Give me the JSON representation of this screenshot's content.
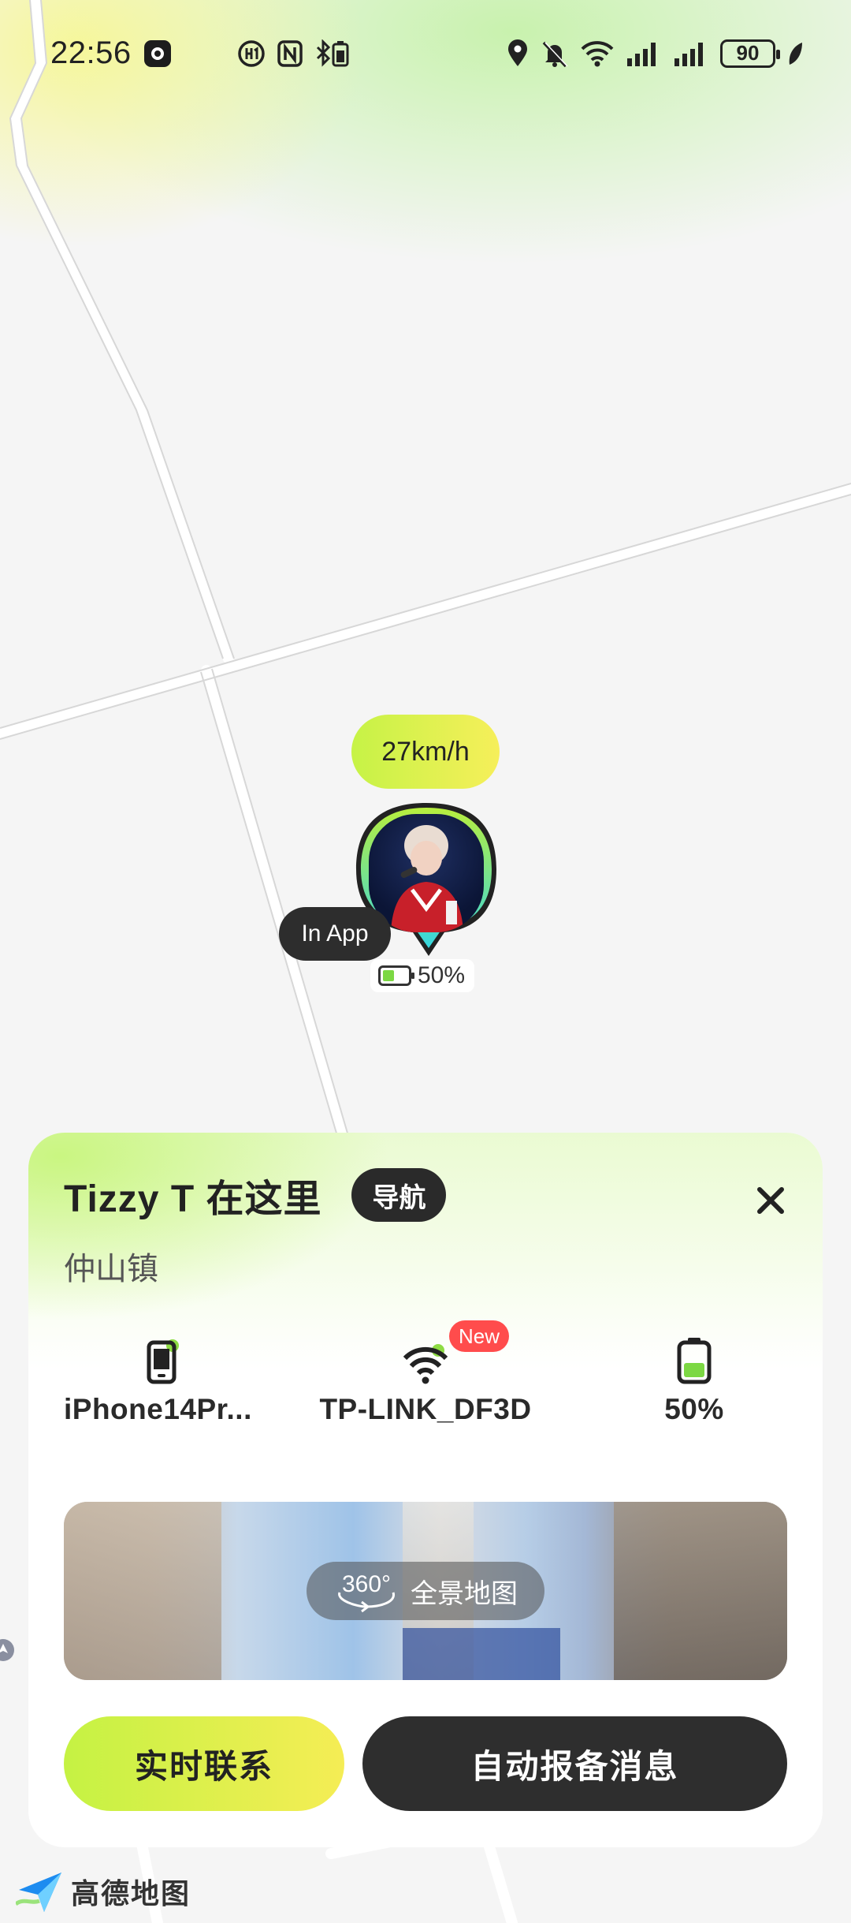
{
  "status_bar": {
    "time": "22:56",
    "battery_level": "90",
    "icons": [
      "app-notification-icon",
      "hd-voice-icon",
      "nfc-icon",
      "bluetooth-battery-icon",
      "location-icon",
      "mute-icon",
      "wifi-icon",
      "signal-icon",
      "signal-icon",
      "battery-icon",
      "leaf-icon"
    ]
  },
  "pin": {
    "speed": "27km/h",
    "status": "In App",
    "battery": "50%"
  },
  "card": {
    "title": "Tizzy T 在这里",
    "nav_label": "导航",
    "location": "仲山镇",
    "stats": [
      {
        "icon": "phone-icon",
        "label": "iPhone14Pr..."
      },
      {
        "icon": "wifi-icon",
        "label": "TP-LINK_DF3D",
        "badge": "New"
      },
      {
        "icon": "battery-icon",
        "label": "50%"
      }
    ],
    "panorama": {
      "badge": "360°",
      "label": "全景地图"
    },
    "buttons": {
      "contact": "实时联系",
      "auto_report": "自动报备消息"
    }
  },
  "map": {
    "logo_text": "高德地图"
  },
  "colors": {
    "accent_green": "#c5f243",
    "accent_yellow": "#f5ed55",
    "dark": "#2e2e2e",
    "badge_red": "#ff4c4c"
  }
}
